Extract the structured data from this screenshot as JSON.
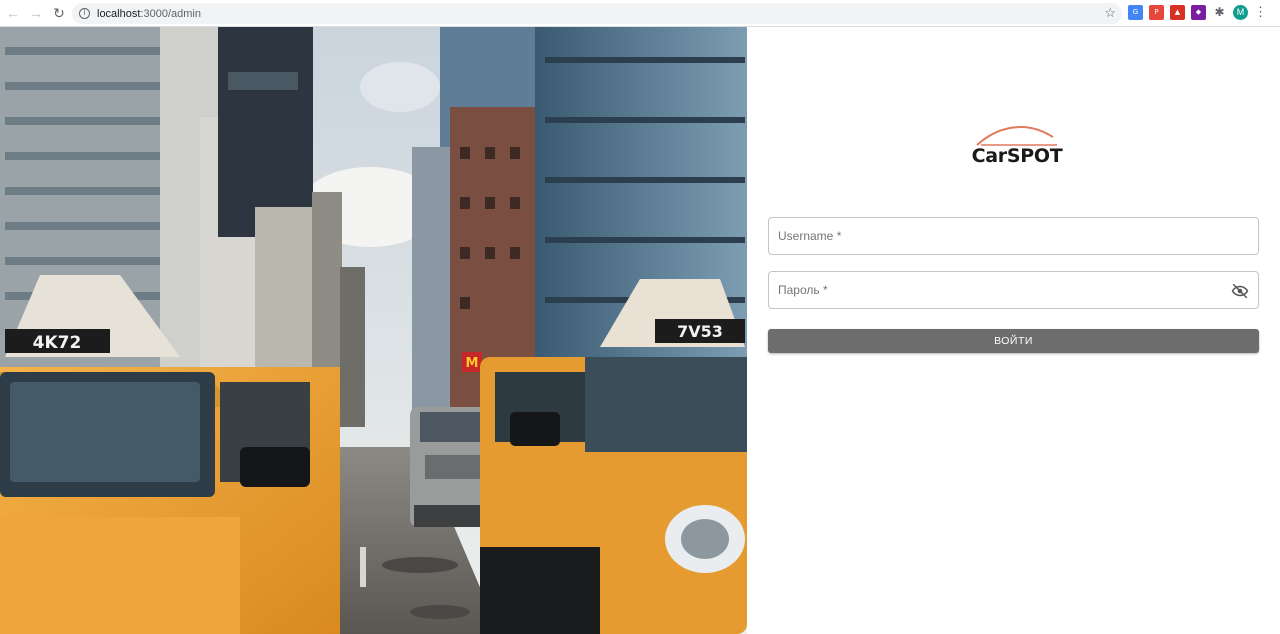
{
  "browser": {
    "url_host": "localhost",
    "url_path": ":3000/admin",
    "profile_initial": "M",
    "extensions": [
      "translate-icon",
      "pdf-icon",
      "red-extension-icon",
      "purple-extension-icon",
      "puzzle-icon"
    ]
  },
  "hero": {
    "left_plate": "4K72",
    "right_plate": "7V53",
    "sign": "M"
  },
  "login": {
    "logo_text": "CarSPOT",
    "username_label": "Username *",
    "password_label": "Пароль *",
    "submit_label": "ВОЙТИ"
  },
  "colors": {
    "logo_arc": "#e07a5f",
    "button": "#6d6d6d",
    "taxi": "#f2a93b"
  }
}
